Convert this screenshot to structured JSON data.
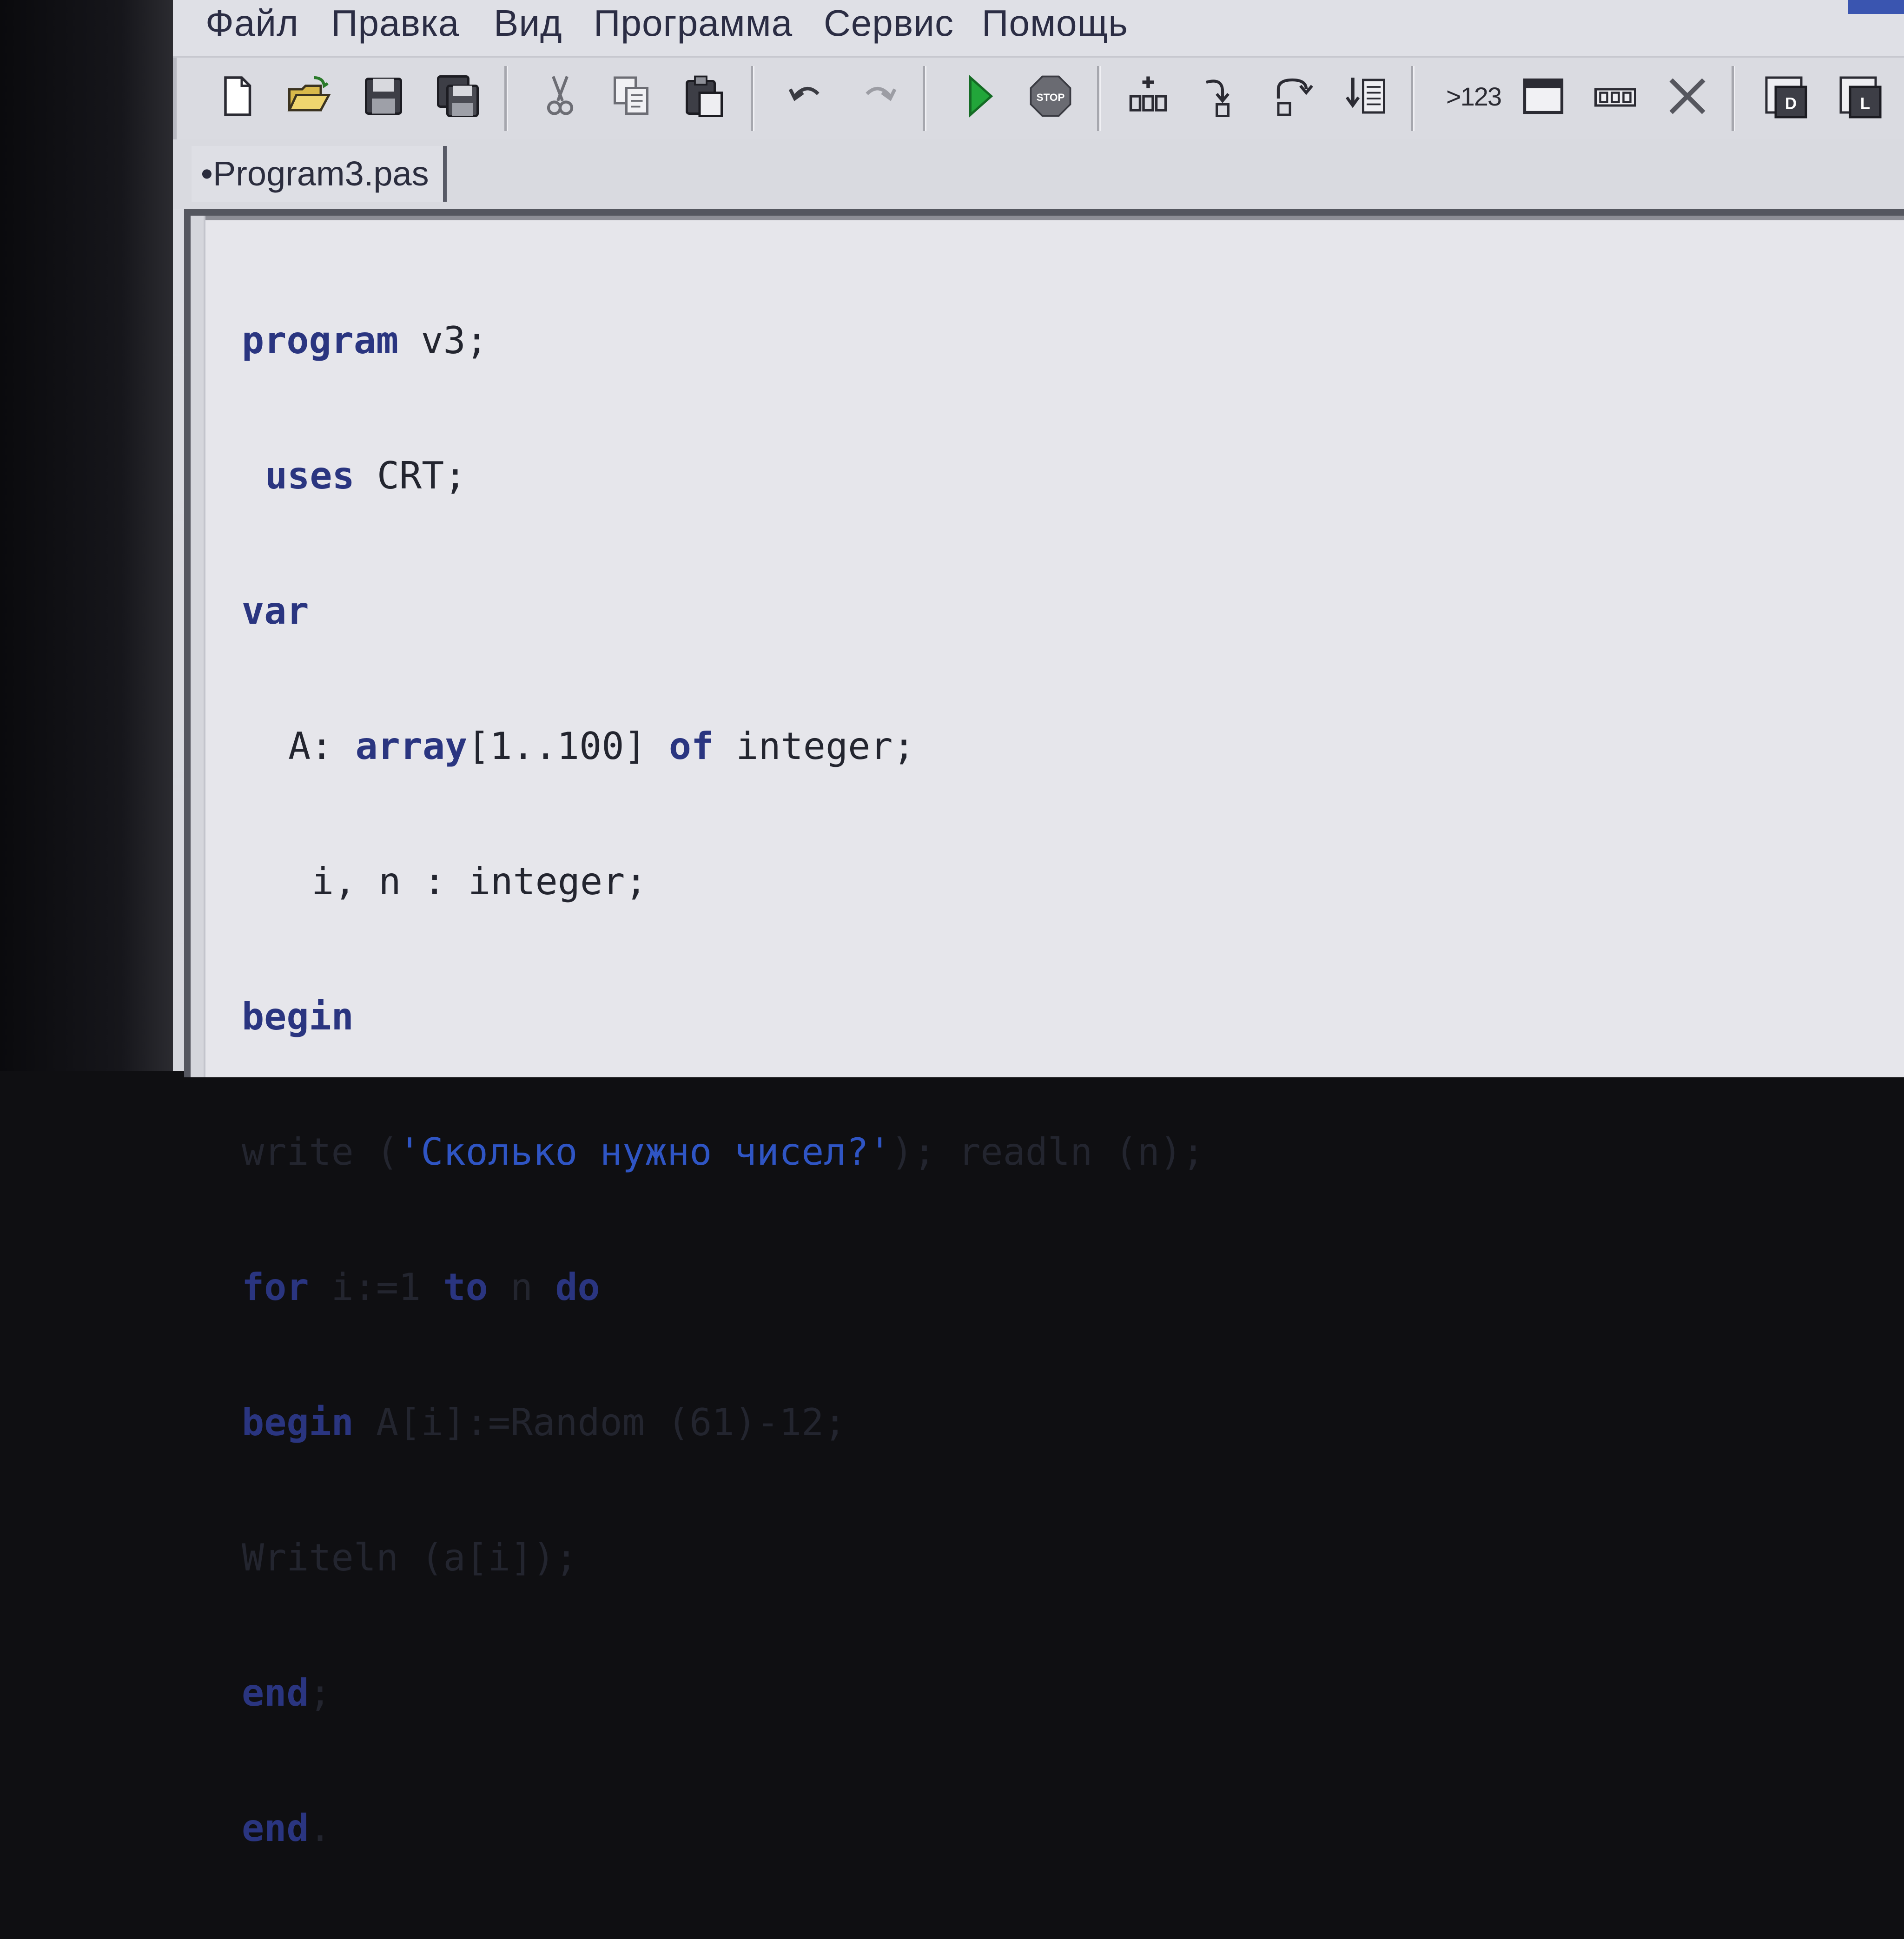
{
  "menu": {
    "items": [
      "Файл",
      "Правка",
      "Вид",
      "Программа",
      "Сервис",
      "Помощь"
    ]
  },
  "toolbar": {
    "buttons": [
      {
        "name": "new-file-icon"
      },
      {
        "name": "open-folder-icon"
      },
      {
        "name": "save-icon"
      },
      {
        "name": "save-all-icon"
      },
      {
        "name": "cut-icon"
      },
      {
        "name": "copy-icon"
      },
      {
        "name": "paste-icon"
      },
      {
        "name": "undo-icon"
      },
      {
        "name": "redo-icon"
      },
      {
        "name": "run-icon"
      },
      {
        "name": "stop-icon"
      },
      {
        "name": "add-watch-icon"
      },
      {
        "name": "step-into-icon"
      },
      {
        "name": "step-over-icon"
      },
      {
        "name": "run-to-cursor-icon"
      },
      {
        "name": "evaluate-icon",
        "label": ">123"
      },
      {
        "name": "output-window-icon"
      },
      {
        "name": "watch-window-icon"
      },
      {
        "name": "close-icon"
      },
      {
        "name": "debug-window-icon"
      },
      {
        "name": "locals-window-icon"
      }
    ],
    "evaluate_label": ">123"
  },
  "tabs": [
    {
      "label": "•Program3.pas"
    }
  ],
  "editor": {
    "lines": [
      {
        "kw1": "program",
        "text": " v3;"
      },
      {
        "kw1": "uses",
        "text": " CRT;"
      },
      {
        "kw1": "var",
        "text": ""
      },
      {
        "text1": "A: ",
        "kw1": "array",
        "text2": "[1..100] ",
        "kw2": "of",
        "text3": " integer;"
      },
      {
        "text": "i, n : integer;"
      },
      {
        "kw1": "begin"
      },
      {
        "text1": "write (",
        "str": "'Сколько нужно чисел?'",
        "text2": "); readln (n);"
      },
      {
        "kw1": "for",
        "text1": " i:=1 ",
        "kw2": "to",
        "text2": " n ",
        "kw3": "do"
      },
      {
        "kw1": "begin",
        "text": " A[i]:=Random (61)-12;"
      },
      {
        "text": "Writeln (a[i]);"
      },
      {
        "kw1": "end",
        "text": ";"
      },
      {
        "kw1": "end",
        "text": "."
      }
    ]
  },
  "colors": {
    "keyword": "#2a3580",
    "string": "#2f55c4",
    "text": "#23252f",
    "run_green": "#22a63a",
    "stop_gray": "#6a6b72"
  }
}
